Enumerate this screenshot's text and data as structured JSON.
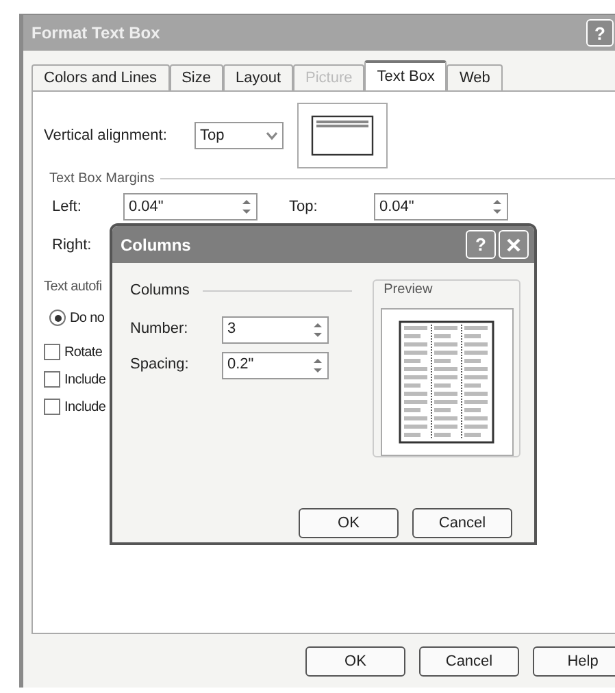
{
  "window": {
    "title": "Format Text Box",
    "help": "?"
  },
  "tabs": [
    {
      "label": "Colors and Lines",
      "selected": false,
      "disabled": false
    },
    {
      "label": "Size",
      "selected": false,
      "disabled": false
    },
    {
      "label": "Layout",
      "selected": false,
      "disabled": false
    },
    {
      "label": "Picture",
      "selected": false,
      "disabled": true
    },
    {
      "label": "Text Box",
      "selected": true,
      "disabled": false
    },
    {
      "label": "Web",
      "selected": false,
      "disabled": false
    }
  ],
  "vertical_alignment": {
    "label": "Vertical alignment:",
    "value": "Top"
  },
  "margins": {
    "title": "Text Box Margins",
    "left": {
      "label": "Left:",
      "value": "0.04\""
    },
    "top": {
      "label": "Top:",
      "value": "0.04\""
    },
    "right": {
      "label": "Right:"
    }
  },
  "autofit": {
    "title": "Text autofi",
    "option": {
      "label": "Do no",
      "selected": true
    }
  },
  "checkboxes": [
    {
      "label": "Rotate",
      "checked": false
    },
    {
      "label": "Include",
      "checked": false
    },
    {
      "label": "Include",
      "checked": false
    }
  ],
  "buttons": [
    "OK",
    "Cancel",
    "Help"
  ],
  "columns_dialog": {
    "title": "Columns",
    "help": "?",
    "section": "Columns",
    "number": {
      "label": "Number:",
      "value": "3"
    },
    "spacing": {
      "label": "Spacing:",
      "value": "0.2\""
    },
    "preview": {
      "title": "Preview"
    },
    "buttons": [
      "OK",
      "Cancel"
    ]
  }
}
